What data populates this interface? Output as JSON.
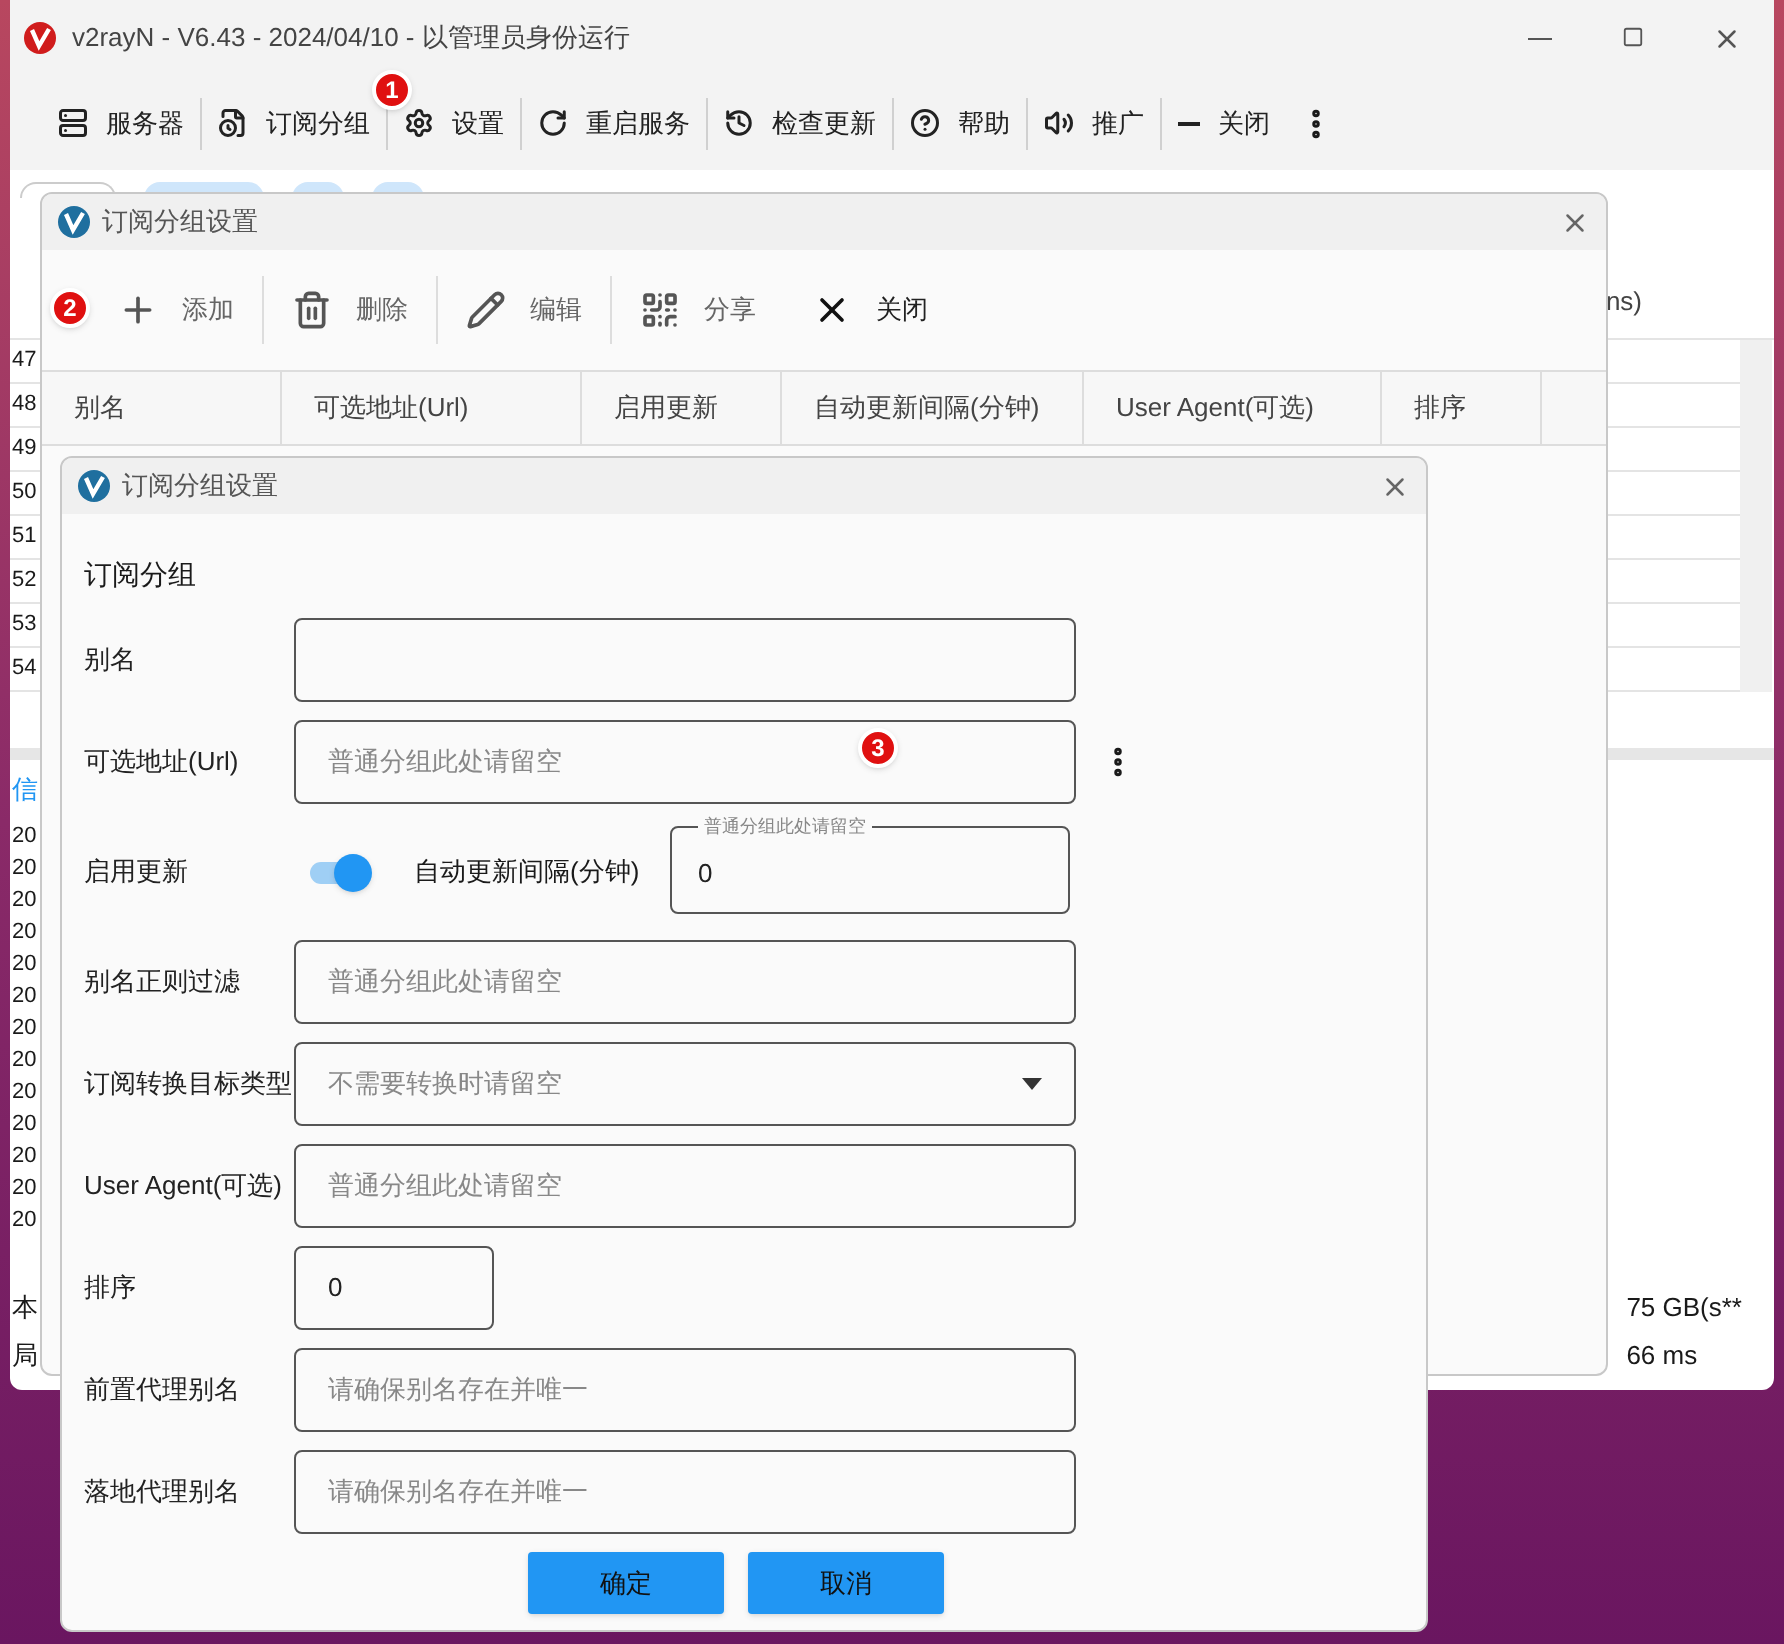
{
  "main_window": {
    "title": "v2rayN - V6.43 - 2024/04/10 - 以管理员身份运行",
    "toolbar": [
      {
        "label": "服务器"
      },
      {
        "label": "订阅分组"
      },
      {
        "label": "设置"
      },
      {
        "label": "重启服务"
      },
      {
        "label": "检查更新"
      },
      {
        "label": "帮助"
      },
      {
        "label": "推广"
      },
      {
        "label": "关闭"
      }
    ],
    "table": {
      "column_partial": "ns)",
      "row_numbers": [
        "47",
        "48",
        "49",
        "50",
        "51",
        "52",
        "53",
        "54"
      ]
    },
    "log_panel": {
      "tab_partial": "信",
      "lines": [
        "20",
        "20",
        "20",
        "20",
        "20",
        "20",
        "20",
        "20",
        "20",
        "20",
        "20",
        "20",
        "20"
      ]
    },
    "status_bar": {
      "left": [
        "本",
        "局"
      ],
      "right": [
        "75 GB(s**",
        "66 ms"
      ]
    }
  },
  "list_window": {
    "title": "订阅分组设置",
    "toolbar": [
      {
        "label": "添加"
      },
      {
        "label": "删除"
      },
      {
        "label": "编辑"
      },
      {
        "label": "分享"
      },
      {
        "label": "关闭"
      }
    ],
    "columns": [
      "别名",
      "可选地址(Url)",
      "启用更新",
      "自动更新间隔(分钟)",
      "User Agent(可选)",
      "排序"
    ]
  },
  "edit_window": {
    "title": "订阅分组设置",
    "section": "订阅分组",
    "fields": [
      {
        "kind": "text",
        "label": "别名"
      },
      {
        "kind": "text",
        "label": "可选地址(Url)",
        "placeholder": "普通分组此处请留空",
        "menu": true
      },
      {
        "kind": "toggle",
        "label": "启用更新",
        "on": true,
        "interval_label": "自动更新间隔(分钟)",
        "interval_hint": "普通分组此处请留空",
        "interval_value": "0"
      },
      {
        "kind": "text",
        "label": "别名正则过滤",
        "placeholder": "普通分组此处请留空"
      },
      {
        "kind": "select",
        "label": "订阅转换目标类型",
        "placeholder": "不需要转换时请留空"
      },
      {
        "kind": "text",
        "label": "User Agent(可选)",
        "placeholder": "普通分组此处请留空"
      },
      {
        "kind": "short",
        "label": "排序",
        "value": "0"
      },
      {
        "kind": "text",
        "label": "前置代理别名",
        "placeholder": "请确保别名存在并唯一"
      },
      {
        "kind": "text",
        "label": "落地代理别名",
        "placeholder": "请确保别名存在并唯一"
      }
    ],
    "buttons": [
      "确定",
      "取消"
    ]
  },
  "markers": [
    "1",
    "2",
    "3"
  ]
}
